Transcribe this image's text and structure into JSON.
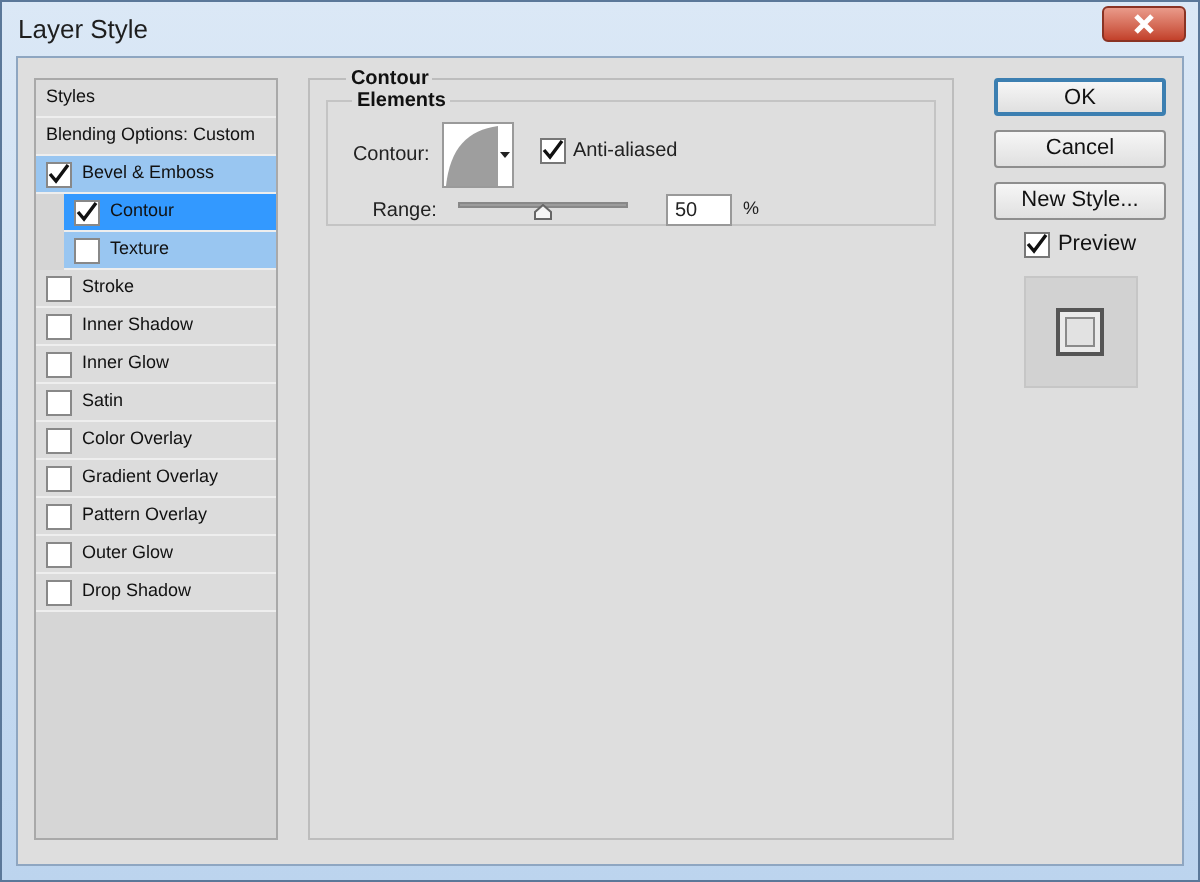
{
  "window": {
    "title": "Layer Style"
  },
  "styles_list": [
    {
      "kind": "header",
      "label": "Styles"
    },
    {
      "kind": "plain",
      "label": "Blending Options: Custom"
    },
    {
      "kind": "check",
      "label": "Bevel & Emboss",
      "checked": true,
      "selected": false,
      "expanded": true,
      "children": [
        {
          "kind": "check",
          "label": "Contour",
          "checked": true,
          "selected": true
        },
        {
          "kind": "check",
          "label": "Texture",
          "checked": false,
          "selected": false
        }
      ]
    },
    {
      "kind": "check",
      "label": "Stroke",
      "checked": false,
      "selected": false
    },
    {
      "kind": "check",
      "label": "Inner Shadow",
      "checked": false,
      "selected": false
    },
    {
      "kind": "check",
      "label": "Inner Glow",
      "checked": false,
      "selected": false
    },
    {
      "kind": "check",
      "label": "Satin",
      "checked": false,
      "selected": false
    },
    {
      "kind": "check",
      "label": "Color Overlay",
      "checked": false,
      "selected": false
    },
    {
      "kind": "check",
      "label": "Gradient Overlay",
      "checked": false,
      "selected": false
    },
    {
      "kind": "check",
      "label": "Pattern Overlay",
      "checked": false,
      "selected": false
    },
    {
      "kind": "check",
      "label": "Outer Glow",
      "checked": false,
      "selected": false
    },
    {
      "kind": "check",
      "label": "Drop Shadow",
      "checked": false,
      "selected": false
    }
  ],
  "panel": {
    "title": "Contour",
    "group": "Elements",
    "contour_label": "Contour:",
    "anti_aliased": {
      "label": "Anti-aliased",
      "checked": true
    },
    "range": {
      "label": "Range:",
      "level": 0.5,
      "value": "50",
      "unit": "%"
    }
  },
  "buttons": [
    {
      "label": "OK",
      "default": true
    },
    {
      "label": "Cancel",
      "default": false
    },
    {
      "label": "New Style...",
      "default": false
    }
  ],
  "preview": {
    "label": "Preview",
    "checked": true
  }
}
